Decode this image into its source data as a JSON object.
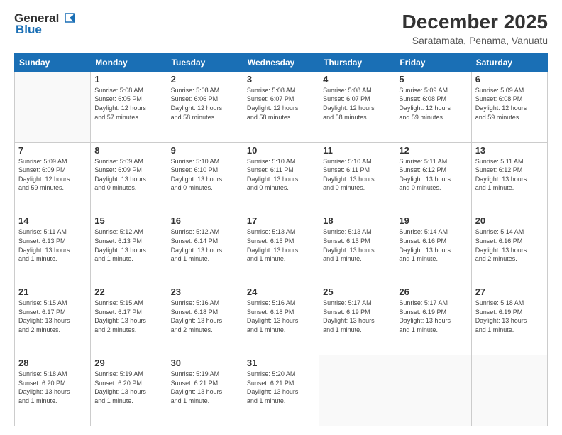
{
  "header": {
    "logo_general": "General",
    "logo_blue": "Blue",
    "title": "December 2025",
    "subtitle": "Saratamata, Penama, Vanuatu"
  },
  "days_of_week": [
    "Sunday",
    "Monday",
    "Tuesday",
    "Wednesday",
    "Thursday",
    "Friday",
    "Saturday"
  ],
  "weeks": [
    [
      {
        "day": "",
        "info": ""
      },
      {
        "day": "1",
        "info": "Sunrise: 5:08 AM\nSunset: 6:05 PM\nDaylight: 12 hours\nand 57 minutes."
      },
      {
        "day": "2",
        "info": "Sunrise: 5:08 AM\nSunset: 6:06 PM\nDaylight: 12 hours\nand 58 minutes."
      },
      {
        "day": "3",
        "info": "Sunrise: 5:08 AM\nSunset: 6:07 PM\nDaylight: 12 hours\nand 58 minutes."
      },
      {
        "day": "4",
        "info": "Sunrise: 5:08 AM\nSunset: 6:07 PM\nDaylight: 12 hours\nand 58 minutes."
      },
      {
        "day": "5",
        "info": "Sunrise: 5:09 AM\nSunset: 6:08 PM\nDaylight: 12 hours\nand 59 minutes."
      },
      {
        "day": "6",
        "info": "Sunrise: 5:09 AM\nSunset: 6:08 PM\nDaylight: 12 hours\nand 59 minutes."
      }
    ],
    [
      {
        "day": "7",
        "info": "Sunrise: 5:09 AM\nSunset: 6:09 PM\nDaylight: 12 hours\nand 59 minutes."
      },
      {
        "day": "8",
        "info": "Sunrise: 5:09 AM\nSunset: 6:09 PM\nDaylight: 13 hours\nand 0 minutes."
      },
      {
        "day": "9",
        "info": "Sunrise: 5:10 AM\nSunset: 6:10 PM\nDaylight: 13 hours\nand 0 minutes."
      },
      {
        "day": "10",
        "info": "Sunrise: 5:10 AM\nSunset: 6:11 PM\nDaylight: 13 hours\nand 0 minutes."
      },
      {
        "day": "11",
        "info": "Sunrise: 5:10 AM\nSunset: 6:11 PM\nDaylight: 13 hours\nand 0 minutes."
      },
      {
        "day": "12",
        "info": "Sunrise: 5:11 AM\nSunset: 6:12 PM\nDaylight: 13 hours\nand 0 minutes."
      },
      {
        "day": "13",
        "info": "Sunrise: 5:11 AM\nSunset: 6:12 PM\nDaylight: 13 hours\nand 1 minute."
      }
    ],
    [
      {
        "day": "14",
        "info": "Sunrise: 5:11 AM\nSunset: 6:13 PM\nDaylight: 13 hours\nand 1 minute."
      },
      {
        "day": "15",
        "info": "Sunrise: 5:12 AM\nSunset: 6:13 PM\nDaylight: 13 hours\nand 1 minute."
      },
      {
        "day": "16",
        "info": "Sunrise: 5:12 AM\nSunset: 6:14 PM\nDaylight: 13 hours\nand 1 minute."
      },
      {
        "day": "17",
        "info": "Sunrise: 5:13 AM\nSunset: 6:15 PM\nDaylight: 13 hours\nand 1 minute."
      },
      {
        "day": "18",
        "info": "Sunrise: 5:13 AM\nSunset: 6:15 PM\nDaylight: 13 hours\nand 1 minute."
      },
      {
        "day": "19",
        "info": "Sunrise: 5:14 AM\nSunset: 6:16 PM\nDaylight: 13 hours\nand 1 minute."
      },
      {
        "day": "20",
        "info": "Sunrise: 5:14 AM\nSunset: 6:16 PM\nDaylight: 13 hours\nand 2 minutes."
      }
    ],
    [
      {
        "day": "21",
        "info": "Sunrise: 5:15 AM\nSunset: 6:17 PM\nDaylight: 13 hours\nand 2 minutes."
      },
      {
        "day": "22",
        "info": "Sunrise: 5:15 AM\nSunset: 6:17 PM\nDaylight: 13 hours\nand 2 minutes."
      },
      {
        "day": "23",
        "info": "Sunrise: 5:16 AM\nSunset: 6:18 PM\nDaylight: 13 hours\nand 2 minutes."
      },
      {
        "day": "24",
        "info": "Sunrise: 5:16 AM\nSunset: 6:18 PM\nDaylight: 13 hours\nand 1 minute."
      },
      {
        "day": "25",
        "info": "Sunrise: 5:17 AM\nSunset: 6:19 PM\nDaylight: 13 hours\nand 1 minute."
      },
      {
        "day": "26",
        "info": "Sunrise: 5:17 AM\nSunset: 6:19 PM\nDaylight: 13 hours\nand 1 minute."
      },
      {
        "day": "27",
        "info": "Sunrise: 5:18 AM\nSunset: 6:19 PM\nDaylight: 13 hours\nand 1 minute."
      }
    ],
    [
      {
        "day": "28",
        "info": "Sunrise: 5:18 AM\nSunset: 6:20 PM\nDaylight: 13 hours\nand 1 minute."
      },
      {
        "day": "29",
        "info": "Sunrise: 5:19 AM\nSunset: 6:20 PM\nDaylight: 13 hours\nand 1 minute."
      },
      {
        "day": "30",
        "info": "Sunrise: 5:19 AM\nSunset: 6:21 PM\nDaylight: 13 hours\nand 1 minute."
      },
      {
        "day": "31",
        "info": "Sunrise: 5:20 AM\nSunset: 6:21 PM\nDaylight: 13 hours\nand 1 minute."
      },
      {
        "day": "",
        "info": ""
      },
      {
        "day": "",
        "info": ""
      },
      {
        "day": "",
        "info": ""
      }
    ]
  ]
}
